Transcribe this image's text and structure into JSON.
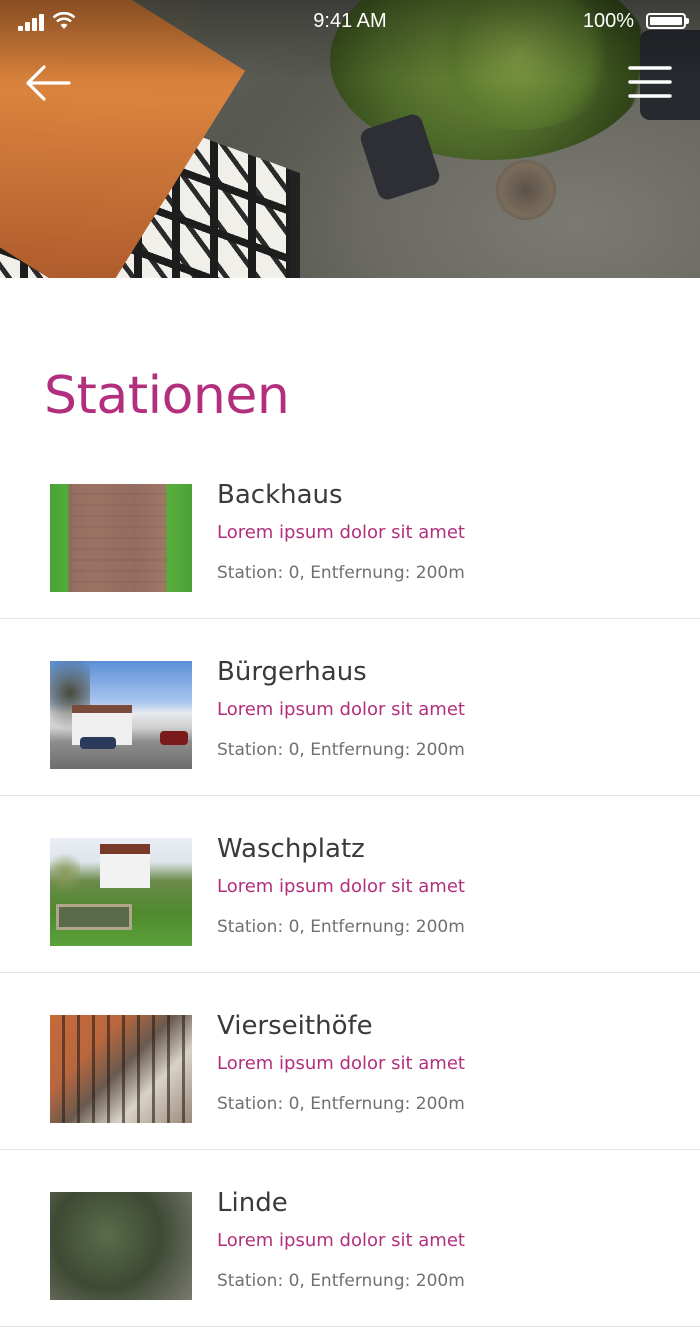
{
  "status_bar": {
    "time": "9:41 AM",
    "battery": "100%"
  },
  "header": {
    "back_icon": "arrow-left-icon",
    "menu_icon": "hamburger-menu-icon",
    "hero_image": "half-timbered-house-aerial-photo"
  },
  "page": {
    "title": "Stationen"
  },
  "stations": [
    {
      "name": "Backhaus",
      "subtitle": "Lorem ipsum dolor sit amet",
      "meta": "Station: 0, Entfernung: 200m"
    },
    {
      "name": "Bürgerhaus",
      "subtitle": "Lorem ipsum dolor sit amet",
      "meta": "Station: 0, Entfernung: 200m"
    },
    {
      "name": "Waschplatz",
      "subtitle": "Lorem ipsum dolor sit amet",
      "meta": "Station: 0, Entfernung: 200m"
    },
    {
      "name": "Vierseithöfe",
      "subtitle": "Lorem ipsum dolor sit amet",
      "meta": "Station: 0, Entfernung: 200m"
    },
    {
      "name": "Linde",
      "subtitle": "Lorem ipsum dolor sit amet",
      "meta": "Station: 0, Entfernung: 200m"
    }
  ],
  "colors": {
    "accent": "#b22f7d",
    "title_text": "#3a3a3a",
    "meta_text": "#707070",
    "divider": "#e6e6e6"
  }
}
